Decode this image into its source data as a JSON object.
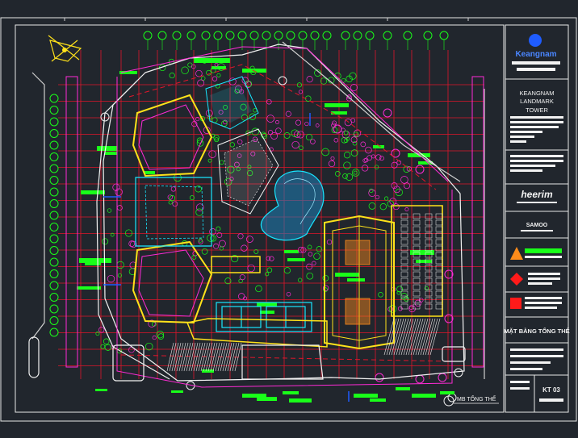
{
  "colors": {
    "background": "#21262d",
    "frame": "#e8e8e8",
    "grid": "#e0162b",
    "magenta": "#ff2bd6",
    "green": "#19ff19",
    "yellow": "#ffe21a",
    "cyan": "#19e6ff",
    "white": "#f2f2f2",
    "blue": "#1f5cff",
    "red": "#ff1a1a",
    "orange": "#ff8c1a"
  },
  "title_block": {
    "brand": "Keangnam",
    "project_line1": "KEANGNAM",
    "project_line2": "LANDMARK",
    "project_line3": "TOWER",
    "consultant_logo": "heerim",
    "partner_logo": "SAMOO",
    "drawing_title": "MẶT BẰNG TỔNG THỂ",
    "sheet_number": "KT 03"
  },
  "drawing": {
    "plan_label": "MB TỔNG THỂ",
    "north_arrow": "north-arrow-icon"
  }
}
